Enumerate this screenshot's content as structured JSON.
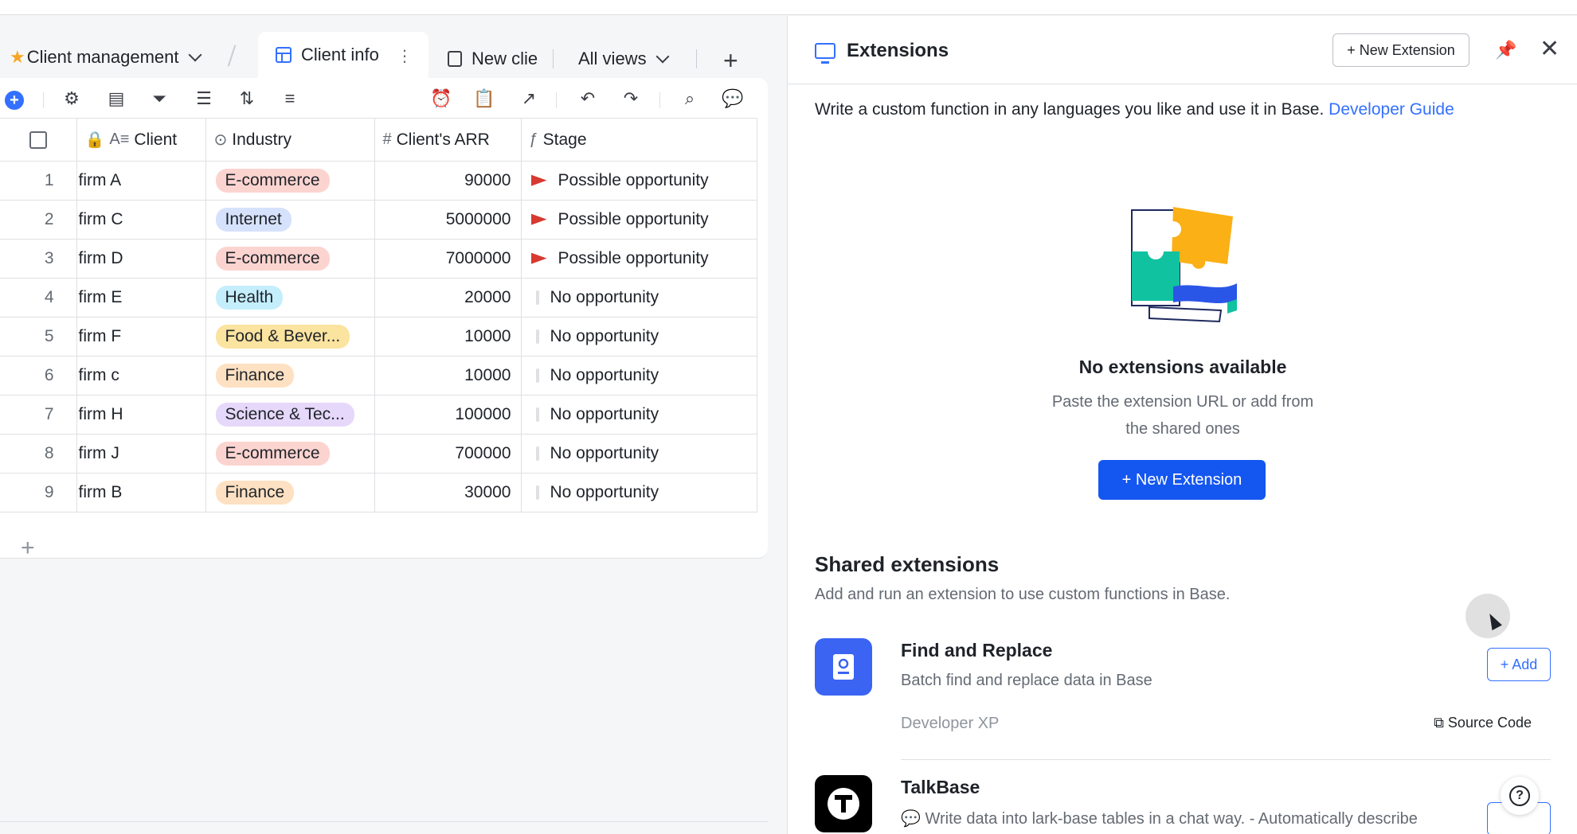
{
  "tabs": {
    "base_name": "Client management",
    "active_tab": "Client info",
    "second_tab": "New clie",
    "all_views": "All views"
  },
  "table": {
    "columns": [
      "Client",
      "Industry",
      "Client's ARR",
      "Stage"
    ],
    "rows": [
      {
        "num": "1",
        "client": "firm A",
        "industry": "E-commerce",
        "arr": "90000",
        "stage": "Possible opportunity"
      },
      {
        "num": "2",
        "client": "firm C",
        "industry": "Internet",
        "arr": "5000000",
        "stage": "Possible opportunity"
      },
      {
        "num": "3",
        "client": "firm D",
        "industry": "E-commerce",
        "arr": "7000000",
        "stage": "Possible opportunity"
      },
      {
        "num": "4",
        "client": "firm E",
        "industry": "Health",
        "arr": "20000",
        "stage": "No opportunity"
      },
      {
        "num": "5",
        "client": "firm F",
        "industry": "Food & Bever...",
        "arr": "10000",
        "stage": "No opportunity"
      },
      {
        "num": "6",
        "client": "firm c",
        "industry": "Finance",
        "arr": "10000",
        "stage": "No opportunity"
      },
      {
        "num": "7",
        "client": "firm H",
        "industry": "Science & Tec...",
        "arr": "100000",
        "stage": "No opportunity"
      },
      {
        "num": "8",
        "client": "firm J",
        "industry": "E-commerce",
        "arr": "700000",
        "stage": "No opportunity"
      },
      {
        "num": "9",
        "client": "firm B",
        "industry": "Finance",
        "arr": "30000",
        "stage": "No opportunity"
      }
    ]
  },
  "tag_colors": {
    "E-commerce": "#fbd4d0",
    "Internet": "#d6e2fc",
    "Health": "#c4eefc",
    "Food & Bever...": "#fbe3a0",
    "Finance": "#fde1c2",
    "Science & Tec...": "#e6d8fa"
  },
  "panel": {
    "title": "Extensions",
    "new_extension_outline": "+ New Extension",
    "description": "Write a custom function in any languages you like and use it in Base.",
    "developer_guide": "Developer Guide",
    "empty_title": "No extensions available",
    "empty_sub_line1": "Paste the extension URL or add from",
    "empty_sub_line2": "the shared ones",
    "new_extension_primary": "+ New Extension",
    "shared_title": "Shared extensions",
    "shared_sub": "Add and run an extension to use custom functions in Base."
  },
  "extensions": [
    {
      "name": "Find and Replace",
      "description": "Batch find and replace data in Base",
      "author": "Developer XP",
      "source_code": "Source Code",
      "add_label": "+ Add"
    },
    {
      "name": "TalkBase",
      "description": "💬 Write data into lark-base tables in a chat way. - Automatically describe"
    }
  ],
  "colors": {
    "accent": "#3370ff",
    "primary_button": "#1456f0",
    "flag_red": "#d83931"
  }
}
